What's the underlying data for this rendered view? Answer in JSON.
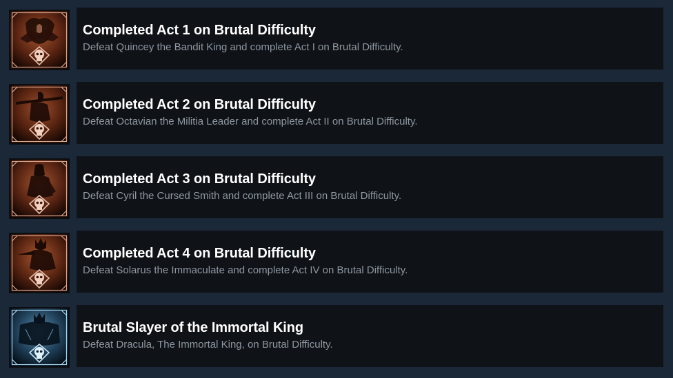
{
  "achievements": [
    {
      "title": "Completed Act 1 on Brutal Difficulty",
      "description": "Defeat Quincey the Bandit King and complete Act I on Brutal Difficulty.",
      "icon": "bandit-king-skull-icon",
      "icon_color": "#c9a08a"
    },
    {
      "title": "Completed Act 2 on Brutal Difficulty",
      "description": "Defeat Octavian the Militia Leader and complete Act II on Brutal Difficulty.",
      "icon": "militia-leader-skull-icon",
      "icon_color": "#c9a08a"
    },
    {
      "title": "Completed Act 3 on Brutal Difficulty",
      "description": "Defeat Cyril the Cursed Smith and complete Act III on Brutal Difficulty.",
      "icon": "cursed-smith-skull-icon",
      "icon_color": "#c9a08a"
    },
    {
      "title": "Completed Act 4 on Brutal Difficulty",
      "description": "Defeat Solarus the Immaculate and complete Act IV on Brutal Difficulty.",
      "icon": "immaculate-skull-icon",
      "icon_color": "#c9a08a"
    },
    {
      "title": "Brutal Slayer of the Immortal King",
      "description": "Defeat Dracula, The Immortal King, on Brutal Difficulty.",
      "icon": "immortal-king-skull-icon",
      "icon_color": "#8fc6e6"
    }
  ],
  "colors": {
    "background": "#1b2838",
    "card": "#0f1217",
    "title": "#ffffff",
    "description": "#8f98a0"
  }
}
